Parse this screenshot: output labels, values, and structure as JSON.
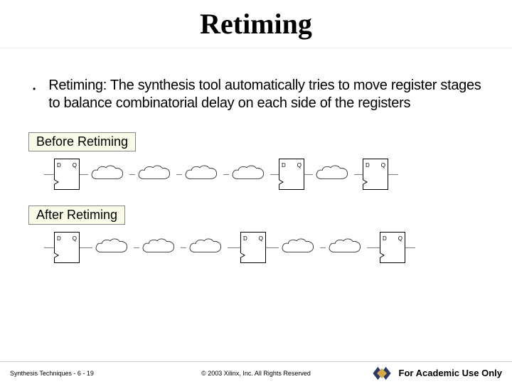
{
  "title": "Retiming",
  "bullet_text": "Retiming: The synthesis tool automatically tries to move register stages to balance combinatorial delay on each side of the registers",
  "labels": {
    "before": "Before Retiming",
    "after": "After Retiming"
  },
  "flop": {
    "d": "D",
    "q": "Q"
  },
  "footer": {
    "left": "Synthesis Techniques  -  6  -  19",
    "center": "© 2003 Xilinx, Inc. All Rights Reserved",
    "right": "For Academic Use Only"
  }
}
